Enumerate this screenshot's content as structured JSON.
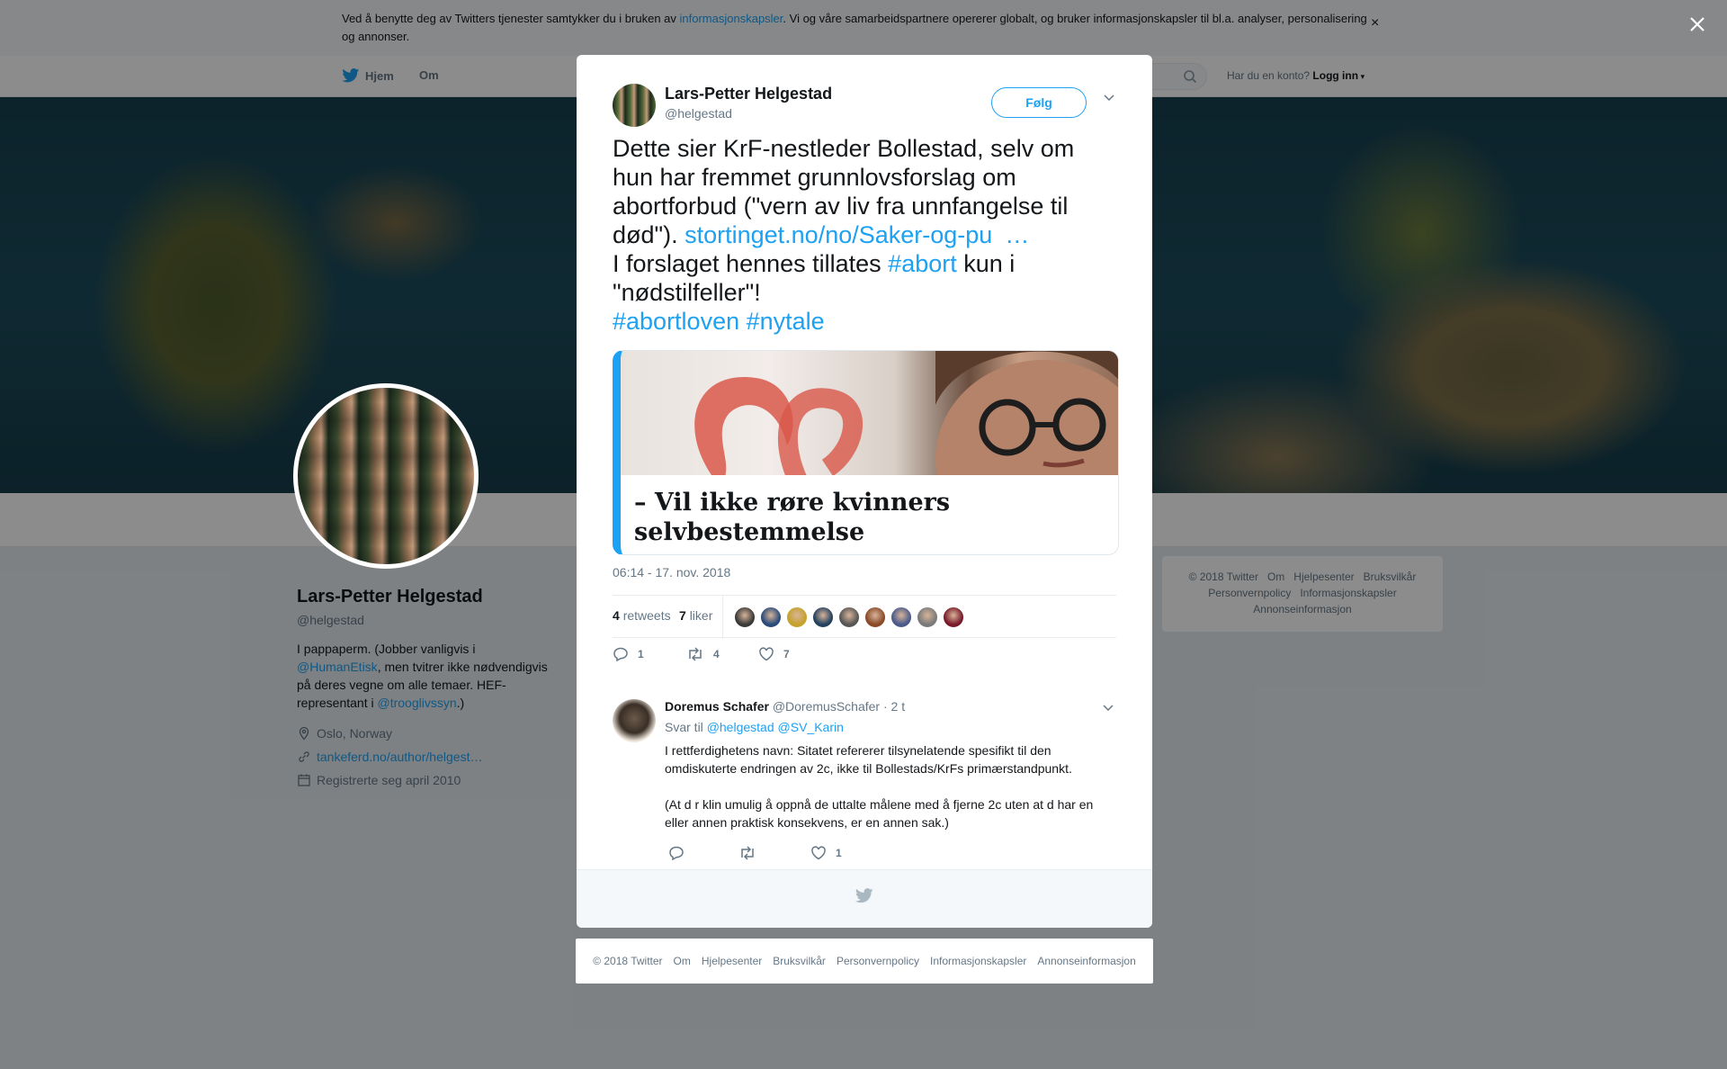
{
  "cookie_bar": {
    "text_before": "Ved å benytte deg av Twitters tjenester samtykker du i bruken av ",
    "link": "informasjonskapsler",
    "text_after": ". Vi og våre samarbeidspartnere opererer globalt, og bruker informasjonskapsler til bl.a. analyser, personalisering og annonser.",
    "close": "×"
  },
  "nav": {
    "home": "Hjem",
    "about": "Om",
    "have_account": "Har du en konto?",
    "login": "Logg inn"
  },
  "profile": {
    "name": "Lars-Petter Helgestad",
    "handle": "@helgestad",
    "bio_1": "I pappaperm. (Jobber vanligvis i ",
    "bio_link_1": "@HumanEtisk",
    "bio_2": ", men tvitrer ikke nødvendigvis på deres vegne om alle temaer. HEF-representant i ",
    "bio_link_2": "@trooglivssyn",
    "bio_3": ".)",
    "location": "Oslo, Norway",
    "website": "tankeferd.no/author/helgest…",
    "joined": "Registrerte seg april 2010"
  },
  "side_footer": [
    "© 2018 Twitter",
    "Om",
    "Hjelpesenter",
    "Bruksvilkår",
    "Personvernpolicy",
    "Informasjonskapsler",
    "Annonseinformasjon"
  ],
  "tweet": {
    "author_name": "Lars-Petter Helgestad",
    "author_handle": "@helgestad",
    "follow": "Følg",
    "text_1": "Dette sier KrF-nestleder Bollestad, selv om hun har fremmet grunnlovsforslag om abortforbud (\"vern av liv fra unnfangelse til død\"). ",
    "link": "stortinget.no/no/Saker-og-pu",
    "ellipsis": "…",
    "text_2": "I forslaget hennes tillates ",
    "hashtag_abort": "#abort",
    "text_3": " kun i \"nødstilfeller\"!",
    "hashtag_abortloven": "#abortloven",
    "hashtag_nytale": "#nytale",
    "card_title": "– Vil ikke røre kvinners selvbestemmelse",
    "timestamp": "06:14 - 17. nov. 2018",
    "retweets_count": "4",
    "retweets_label": "retweets",
    "likes_count": "7",
    "likes_label": "liker",
    "reply_count": "1",
    "retweet_count_action": "4",
    "like_count_action": "7"
  },
  "reply": {
    "name": "Doremus Schafer",
    "handle": "@DoremusSchafer",
    "time": "· 2 t",
    "reply_to_label": "Svar til",
    "reply_to_1": "@helgestad",
    "reply_to_2": "@SV_Karin",
    "body_1": "I rettferdighetens navn: Sitatet refererer tilsynelatende spesifikt til den omdiskuterte endringen av 2c, ikke til Bollestads/KrFs primærstandpunkt.",
    "body_2": "(At d r klin umulig å oppnå de uttalte målene med å fjerne 2c uten at d har en eller annen praktisk konsekvens, er en annen sak.)",
    "like_count": "1"
  },
  "modal_footer": [
    "© 2018 Twitter",
    "Om",
    "Hjelpesenter",
    "Bruksvilkår",
    "Personvernpolicy",
    "Informasjonskapsler",
    "Annonseinformasjon"
  ],
  "colors": {
    "accent": "#1da1f2",
    "text": "#14171a",
    "muted": "#657786"
  },
  "liker_colors": [
    "#3a3a3a",
    "#2a4a7a",
    "#c5a22a",
    "#23415e",
    "#555555",
    "#8a4a2a",
    "#4a5a8a",
    "#7a7a7a",
    "#7a1a2a"
  ]
}
